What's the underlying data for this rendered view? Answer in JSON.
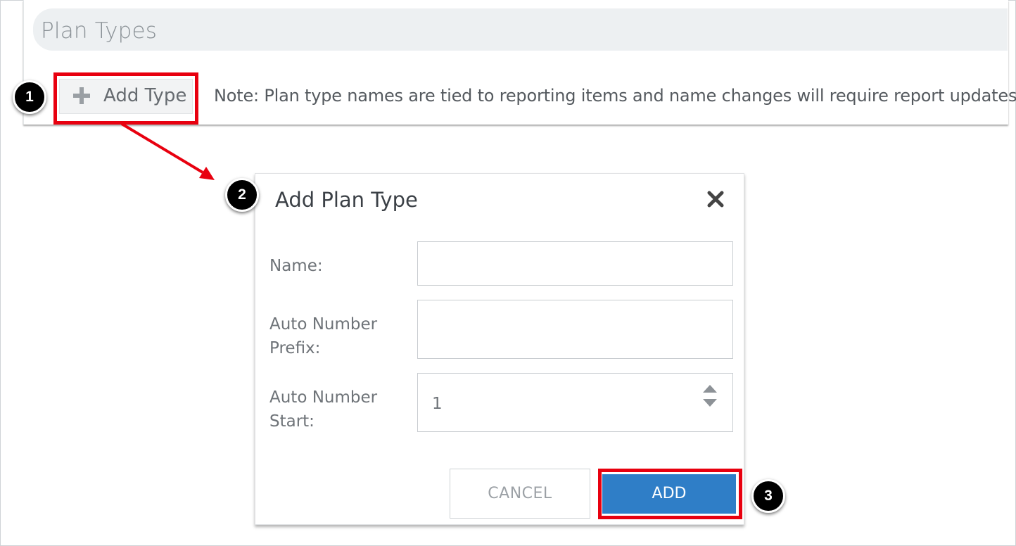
{
  "page": {
    "title": "Plan Types"
  },
  "toolbar": {
    "add_type_label": "Add Type",
    "note": "Note: Plan type names are tied to reporting items and name changes will require report updates."
  },
  "steps": [
    "1",
    "2",
    "3"
  ],
  "dialog": {
    "title": "Add Plan Type",
    "fields": {
      "name": {
        "label": "Name:",
        "value": ""
      },
      "prefix": {
        "label_line1": "Auto Number",
        "label_line2": "Prefix:",
        "value": ""
      },
      "start": {
        "label_line1": "Auto Number",
        "label_line2": "Start:",
        "value": "1"
      }
    },
    "cancel_label": "CANCEL",
    "add_label": "ADD"
  },
  "icons": {
    "add": "plus-icon",
    "close": "close-icon",
    "spinner": "spinner-icon"
  },
  "colors": {
    "highlight": "#e8000f",
    "primary": "#2f7ec7",
    "badge": "#000000"
  }
}
